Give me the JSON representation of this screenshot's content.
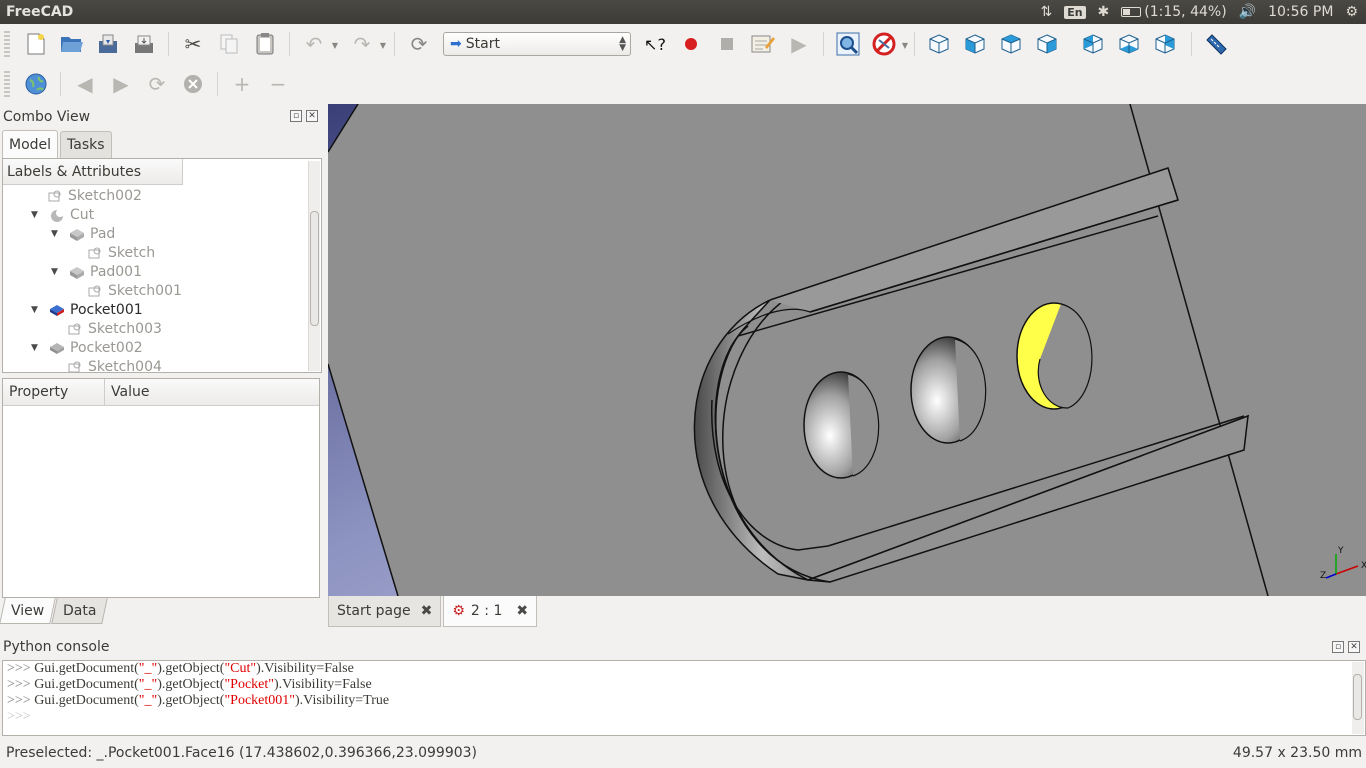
{
  "window": {
    "title": "FreeCAD"
  },
  "tray": {
    "lang": "En",
    "battery": "(1:15, 44%)",
    "battery_level": 0.44,
    "time": "10:56 PM"
  },
  "toolbar": {
    "workbench": "Start"
  },
  "combo_view": {
    "title": "Combo View",
    "tabs": [
      "Model",
      "Tasks"
    ],
    "tree_header": "Labels & Attributes",
    "tree_items": [
      {
        "label": "Sketch002",
        "state": "hidden"
      },
      {
        "label": "Cut",
        "state": "hidden"
      },
      {
        "label": "Pad",
        "state": "hidden"
      },
      {
        "label": "Sketch",
        "state": "hidden"
      },
      {
        "label": "Pad001",
        "state": "hidden"
      },
      {
        "label": "Sketch001",
        "state": "hidden"
      },
      {
        "label": "Pocket001",
        "state": "visible"
      },
      {
        "label": "Sketch003",
        "state": "hidden"
      },
      {
        "label": "Pocket002",
        "state": "hidden"
      },
      {
        "label": "Sketch004",
        "state": "hidden"
      }
    ],
    "property_columns": [
      "Property",
      "Value"
    ],
    "bottom_tabs": [
      "View",
      "Data"
    ]
  },
  "view_tabs": [
    {
      "label": "Start page"
    },
    {
      "label": "2 : 1"
    }
  ],
  "python_console": {
    "title": "Python console",
    "lines": [
      {
        "prompt": ">>>",
        "pre": " Gui.getDocument(",
        "doc": "\"_\"",
        "mid": ").getObject(",
        "obj": "\"Cut\"",
        "post": ").Visibility=False"
      },
      {
        "prompt": ">>>",
        "pre": " Gui.getDocument(",
        "doc": "\"_\"",
        "mid": ").getObject(",
        "obj": "\"Pocket\"",
        "post": ").Visibility=False"
      },
      {
        "prompt": ">>>",
        "pre": " Gui.getDocument(",
        "doc": "\"_\"",
        "mid": ").getObject(",
        "obj": "\"Pocket001\"",
        "post": ").Visibility=True"
      },
      {
        "prompt": ">>>",
        "pre": "",
        "doc": "",
        "mid": "",
        "obj": "",
        "post": ""
      }
    ]
  },
  "status": {
    "message": "Preselected: _.Pocket001.Face16 (17.438602,0.396366,23.099903)",
    "dimensions": "49.57 x 23.50 mm"
  },
  "axis_labels": {
    "x": "X",
    "y": "Y",
    "z": "Z"
  },
  "colors": {
    "highlight": "#ffff4a",
    "model_gray": "#909090",
    "background_blue": "#4a4f8e",
    "selected_body": "#2f5fcf"
  }
}
